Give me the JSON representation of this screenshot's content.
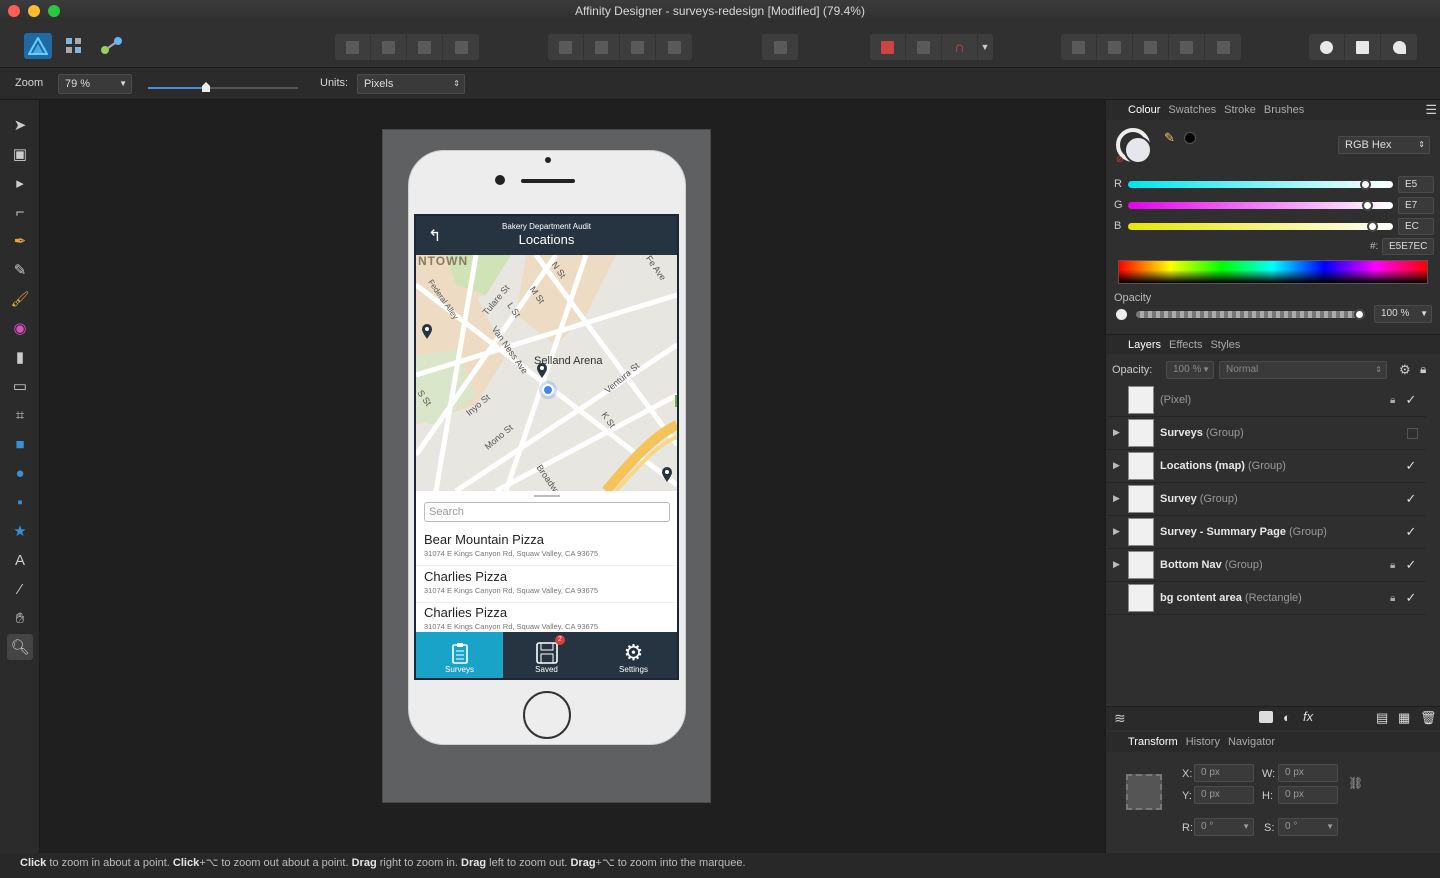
{
  "window": {
    "title": "Affinity Designer - surveys-redesign [Modified] (79.4%)",
    "traffic_colors": [
      "#fd5f57",
      "#febc2e",
      "#28c840"
    ]
  },
  "context_bar": {
    "zoom_label": "Zoom",
    "zoom_value": "79 %",
    "units_label": "Units:",
    "units_value": "Pixels"
  },
  "tools": [
    "move-tool-icon",
    "artboard-tool-icon",
    "node-tool-icon",
    "corner-tool-icon",
    "pen-tool-icon",
    "pencil-tool-icon",
    "brush-tool-icon",
    "fill-tool-icon",
    "transparency-tool-icon",
    "place-image-icon",
    "crop-tool-icon",
    "rectangle-tool-icon",
    "ellipse-tool-icon",
    "rounded-rect-tool-icon",
    "star-tool-icon",
    "text-tool-icon",
    "colour-picker-icon",
    "hand-tool-icon",
    "zoom-tool-icon"
  ],
  "phone": {
    "header_subtitle": "Bakery Department Audit",
    "header_title": "Locations",
    "map_labels": {
      "district": "NTOWN",
      "arena": "Selland Arena",
      "streets": [
        "Tulare St",
        "Federal Alley",
        "Van Ness Ave",
        "M St",
        "N St",
        "L St",
        "Ventura St",
        "Inyo St",
        "Mono St",
        "K St",
        "Fe Ave",
        "S St",
        "Broadway"
      ]
    },
    "search_placeholder": "Search",
    "locations": [
      {
        "name": "Bear Mountain Pizza",
        "address": "31074 E Kings Canyon Rd, Squaw Valley, CA 93675"
      },
      {
        "name": "Charlies Pizza",
        "address": "31074 E Kings Canyon Rd, Squaw Valley, CA 93675"
      },
      {
        "name": "Charlies Pizza",
        "address": "31074 E Kings Canyon Rd, Squaw Valley, CA 93675"
      }
    ],
    "tabs": [
      {
        "label": "Surveys",
        "icon": "clipboard-icon"
      },
      {
        "label": "Saved",
        "icon": "floppy-icon",
        "badge": "2"
      },
      {
        "label": "Settings",
        "icon": "gear-icon"
      }
    ]
  },
  "colour_panel": {
    "tabs": [
      "Colour",
      "Swatches",
      "Stroke",
      "Brushes"
    ],
    "mode": "RGB Hex",
    "channels": [
      {
        "label": "R",
        "value": "E5",
        "level": 0.898
      },
      {
        "label": "G",
        "value": "E7",
        "level": 0.906
      },
      {
        "label": "B",
        "value": "EC",
        "level": 0.925
      }
    ],
    "hex_label": "#:",
    "hex_value": "E5E7EC",
    "opacity_label": "Opacity",
    "opacity_value": "100 %"
  },
  "layers_panel": {
    "tabs": [
      "Layers",
      "Effects",
      "Styles"
    ],
    "opacity_label": "Opacity:",
    "opacity_value": "100 %",
    "blend_mode": "Normal",
    "layers": [
      {
        "name": "",
        "type": "(Pixel)",
        "expandable": false,
        "locked": true,
        "visible": true
      },
      {
        "name": "Surveys",
        "type": "(Group)",
        "expandable": true,
        "locked": false,
        "visible": false
      },
      {
        "name": "Locations (map)",
        "type": "(Group)",
        "expandable": true,
        "locked": false,
        "visible": true
      },
      {
        "name": "Survey",
        "type": "(Group)",
        "expandable": true,
        "locked": false,
        "visible": true
      },
      {
        "name": "Survey - Summary Page",
        "type": "(Group)",
        "expandable": true,
        "locked": false,
        "visible": true
      },
      {
        "name": "Bottom Nav",
        "type": "(Group)",
        "expandable": true,
        "locked": true,
        "visible": true
      },
      {
        "name": "bg content area",
        "type": "(Rectangle)",
        "expandable": false,
        "locked": true,
        "visible": true
      }
    ]
  },
  "transform_panel": {
    "tabs": [
      "Transform",
      "History",
      "Navigator"
    ],
    "x_label": "X:",
    "x_value": "0 px",
    "y_label": "Y:",
    "y_value": "0 px",
    "w_label": "W:",
    "w_value": "0 px",
    "h_label": "H:",
    "h_value": "0 px",
    "r_label": "R:",
    "r_value": "0 °",
    "s_label": "S:",
    "s_value": "0 °"
  },
  "status": {
    "parts": [
      {
        "bold": true,
        "text": "Click"
      },
      {
        "bold": false,
        "text": " to zoom in about a point. "
      },
      {
        "bold": true,
        "text": "Click"
      },
      {
        "bold": false,
        "text": "+⌥ to zoom out about a point. "
      },
      {
        "bold": true,
        "text": "Drag"
      },
      {
        "bold": false,
        "text": " right to zoom in. "
      },
      {
        "bold": true,
        "text": "Drag"
      },
      {
        "bold": false,
        "text": " left to zoom out. "
      },
      {
        "bold": true,
        "text": "Drag"
      },
      {
        "bold": false,
        "text": "+⌥ to zoom into the marquee."
      }
    ]
  }
}
